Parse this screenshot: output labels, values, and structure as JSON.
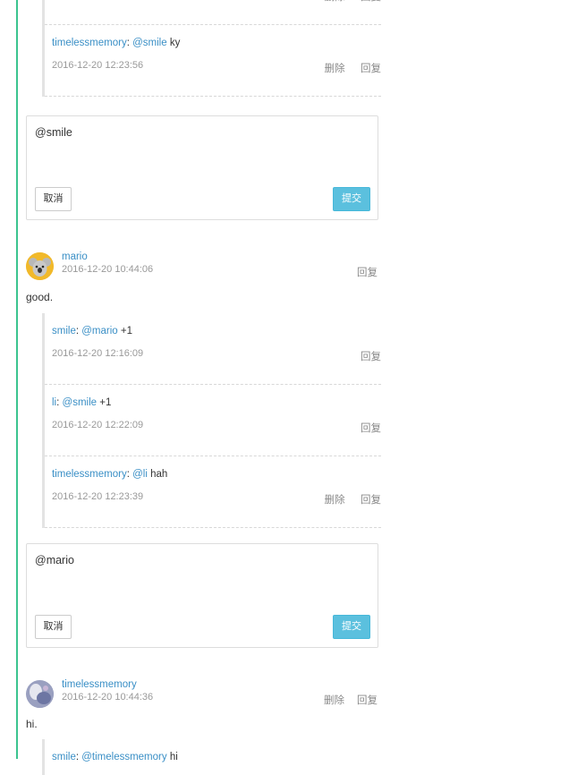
{
  "labels": {
    "delete": "删除",
    "reply": "回复",
    "cancel": "取消",
    "submit": "提交"
  },
  "top_reply": {
    "user": "timelessmemory",
    "mention": "@smile",
    "text": "ky",
    "time": "2016-12-20 12:23:56"
  },
  "form1": {
    "value": "@smile"
  },
  "comment_mario": {
    "user": "mario",
    "time": "2016-12-20 10:44:06",
    "body": "good.",
    "replies": [
      {
        "user": "smile",
        "mention": "@mario",
        "text": "+1",
        "time": "2016-12-20 12:16:09"
      },
      {
        "user": "li",
        "mention": "@smile",
        "text": "+1",
        "time": "2016-12-20 12:22:09"
      },
      {
        "user": "timelessmemory",
        "mention": "@li",
        "text": "hah",
        "time": "2016-12-20 12:23:39"
      }
    ]
  },
  "form2": {
    "value": "@mario"
  },
  "comment_timeless": {
    "user": "timelessmemory",
    "time": "2016-12-20 10:44:36",
    "body": "hi.",
    "replies": [
      {
        "user": "smile",
        "mention": "@timelessmemory",
        "text": "hi"
      }
    ]
  },
  "colors": {
    "accent": "#3a8fc6",
    "rule": "#3bc48f",
    "submit": "#5bc0de"
  }
}
